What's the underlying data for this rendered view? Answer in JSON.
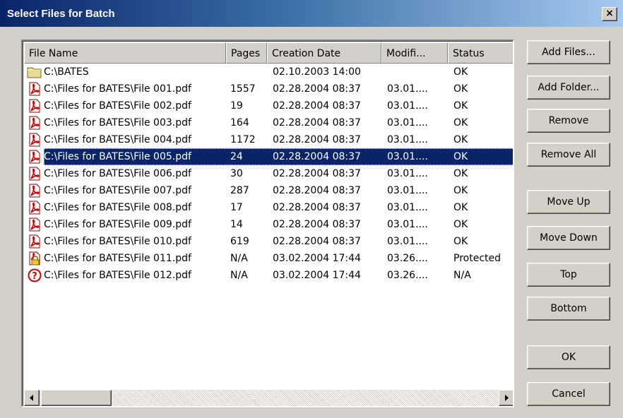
{
  "window": {
    "title": "Select Files for Batch",
    "close_glyph": "×"
  },
  "columns": [
    "File Name",
    "Pages",
    "Creation Date",
    "Modifi...",
    "Status"
  ],
  "rows": [
    {
      "icon": "folder-icon",
      "name": "C:\\BATES",
      "pages": "",
      "created": "02.10.2003 14:00",
      "modified": "",
      "status": "OK"
    },
    {
      "icon": "pdf-icon",
      "name": "C:\\Files for BATES\\File 001.pdf",
      "pages": "1557",
      "created": "02.28.2004 08:37",
      "modified": "03.01....",
      "status": "OK"
    },
    {
      "icon": "pdf-icon",
      "name": "C:\\Files for BATES\\File 002.pdf",
      "pages": "19",
      "created": "02.28.2004 08:37",
      "modified": "03.01....",
      "status": "OK"
    },
    {
      "icon": "pdf-icon",
      "name": "C:\\Files for BATES\\File 003.pdf",
      "pages": "164",
      "created": "02.28.2004 08:37",
      "modified": "03.01....",
      "status": "OK"
    },
    {
      "icon": "pdf-icon",
      "name": "C:\\Files for BATES\\File 004.pdf",
      "pages": "1172",
      "created": "02.28.2004 08:37",
      "modified": "03.01....",
      "status": "OK"
    },
    {
      "icon": "pdf-icon",
      "name": "C:\\Files for BATES\\File 005.pdf",
      "pages": "24",
      "created": "02.28.2004 08:37",
      "modified": "03.01....",
      "status": "OK",
      "selected": true
    },
    {
      "icon": "pdf-icon",
      "name": "C:\\Files for BATES\\File 006.pdf",
      "pages": "30",
      "created": "02.28.2004 08:37",
      "modified": "03.01....",
      "status": "OK"
    },
    {
      "icon": "pdf-icon",
      "name": "C:\\Files for BATES\\File 007.pdf",
      "pages": "287",
      "created": "02.28.2004 08:37",
      "modified": "03.01....",
      "status": "OK"
    },
    {
      "icon": "pdf-icon",
      "name": "C:\\Files for BATES\\File 008.pdf",
      "pages": "17",
      "created": "02.28.2004 08:37",
      "modified": "03.01....",
      "status": "OK"
    },
    {
      "icon": "pdf-icon",
      "name": "C:\\Files for BATES\\File 009.pdf",
      "pages": "14",
      "created": "02.28.2004 08:37",
      "modified": "03.01....",
      "status": "OK"
    },
    {
      "icon": "pdf-icon",
      "name": "C:\\Files for BATES\\File 010.pdf",
      "pages": "619",
      "created": "02.28.2004 08:37",
      "modified": "03.01....",
      "status": "OK"
    },
    {
      "icon": "pdf-locked-icon",
      "name": "C:\\Files for BATES\\File 011.pdf",
      "pages": "N/A",
      "created": "03.02.2004 17:44",
      "modified": "03.26....",
      "status": "Protected"
    },
    {
      "icon": "question-icon",
      "name": "C:\\Files for BATES\\File 012.pdf",
      "pages": "N/A",
      "created": "03.02.2004 17:44",
      "modified": "03.26....",
      "status": "N/A"
    }
  ],
  "buttons": {
    "add_files": "Add Files...",
    "add_folder": "Add Folder...",
    "remove": "Remove",
    "remove_all": "Remove All",
    "move_up": "Move Up",
    "move_down": "Move Down",
    "top": "Top",
    "bottom": "Bottom",
    "ok": "OK",
    "cancel": "Cancel"
  },
  "colors": {
    "selection": "#0a246a",
    "face": "#d4d0c8",
    "pdf_red": "#cc0000"
  }
}
